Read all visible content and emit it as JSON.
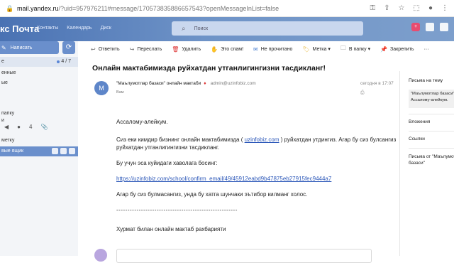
{
  "browser": {
    "url_host": "mail.yandex.ru",
    "url_rest": "/?uid=957976211#message/170573835886657543?openMessageInList=false",
    "icons": [
      "lock-icon",
      "key-icon",
      "share-icon",
      "star-icon",
      "extensions-icon",
      "profile-icon",
      "menu-icon"
    ]
  },
  "header": {
    "logo": "Яндекс Почта",
    "logo_visible": "кс Почта",
    "nav": [
      "Контакты",
      "Календарь",
      "Диск"
    ],
    "search_placeholder": "Поиск"
  },
  "sidebar": {
    "compose_label": "Написать",
    "folders": [
      {
        "label": "е",
        "count": "4 / 7",
        "active": true,
        "dot": true
      },
      {
        "label": "енные",
        "count": ""
      },
      {
        "label": "ые",
        "count": ""
      },
      {
        "label": "",
        "count": ""
      },
      {
        "label": "папку",
        "count": ""
      },
      {
        "label": "и",
        "count": ""
      }
    ],
    "icon_row_label": "4",
    "meta_label": "метку",
    "user_label": "вые ящик"
  },
  "toolbar": {
    "items": [
      {
        "icon": "reply-icon",
        "label": "Ответить"
      },
      {
        "icon": "forward-icon",
        "label": "Переслать"
      },
      {
        "icon": "trash-icon",
        "label": "Удалить"
      },
      {
        "icon": "spam-icon",
        "label": "Это спам!"
      },
      {
        "icon": "unread-icon",
        "label": "Не прочитано"
      },
      {
        "icon": "label-icon",
        "label": "Метка ▾"
      },
      {
        "icon": "folder-icon",
        "label": "В папку ▾"
      },
      {
        "icon": "pin-icon",
        "label": "Закрепить"
      },
      {
        "icon": "more-icon",
        "label": "···"
      }
    ]
  },
  "message": {
    "subject": "Онлайн мактабимизда руйхатдан утганлигингизни тасдикланг!",
    "avatar_letter": "М",
    "sender_name": "\"Маълумотлар базаси\" онлайн мактаби",
    "sender_email": "admin@uzinfobiz.com",
    "to": "Вам",
    "date": "сегодня в 17:07",
    "body": {
      "greeting": "Ассалому-алейкум.",
      "p1_a": "Сиз еки кимдир бизнинг онлайн мактабимизда ( ",
      "p1_link": "uzinfobiz.com",
      "p1_b": " ) руйхатдан утдингиз. Агар бу сиз булсангиз руйхатдан утганлигингизни тасдикланг.",
      "p2": "Бу учун эса куйидаги хаволага босинг:",
      "confirm_link": "https://uzinfobiz.com/school/confirm_email/49/45912eabd9b47875eb27915fec9444a7",
      "p3": "Агар бу сиз булмасангиз, унда бу хатга шунчаки эътибор килманг холос.",
      "separator": "------------------------------------------------------",
      "signature": "Хурмат билан онлайн мактаб рахбарияти"
    }
  },
  "right_panel": {
    "title_thread": "Письма на тему",
    "thread_card_1": "\"Маълумотлар базаси\"",
    "thread_card_2": "Ассалому-алейкум.",
    "attachments": "Вложения",
    "links": "Ссылки",
    "from_sender_1": "Письма от \"Маълумотлар",
    "from_sender_2": "базаси\""
  }
}
